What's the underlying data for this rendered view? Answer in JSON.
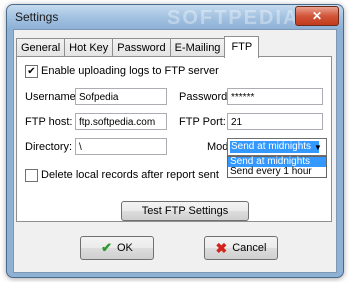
{
  "window": {
    "title": "Settings",
    "watermark": "SOFTPEDIA",
    "close_glyph": "✕"
  },
  "tabs": [
    {
      "label": "General"
    },
    {
      "label": "Hot Key"
    },
    {
      "label": "Password"
    },
    {
      "label": "E-Mailing"
    },
    {
      "label": "FTP"
    }
  ],
  "ftp": {
    "enable_label": "Enable uploading logs to FTP server",
    "enable_checked": "✔",
    "username_label": "Username:",
    "username_value": "Sofpedia",
    "password_label": "Password:",
    "password_value": "******",
    "host_label": "FTP host:",
    "host_value": "ftp.softpedia.com",
    "port_label": "FTP Port:",
    "port_value": "21",
    "directory_label": "Directory:",
    "directory_value": "\\",
    "mode_label": "Mode:",
    "mode_value": "Send at midnights",
    "mode_options": [
      "Send at midnights",
      "Send every 1 hour"
    ],
    "delete_label": "Delete local records after report sent",
    "test_button": "Test FTP Settings"
  },
  "buttons": {
    "ok": "OK",
    "cancel": "Cancel",
    "ok_icon": "✔",
    "cancel_icon": "✖"
  }
}
